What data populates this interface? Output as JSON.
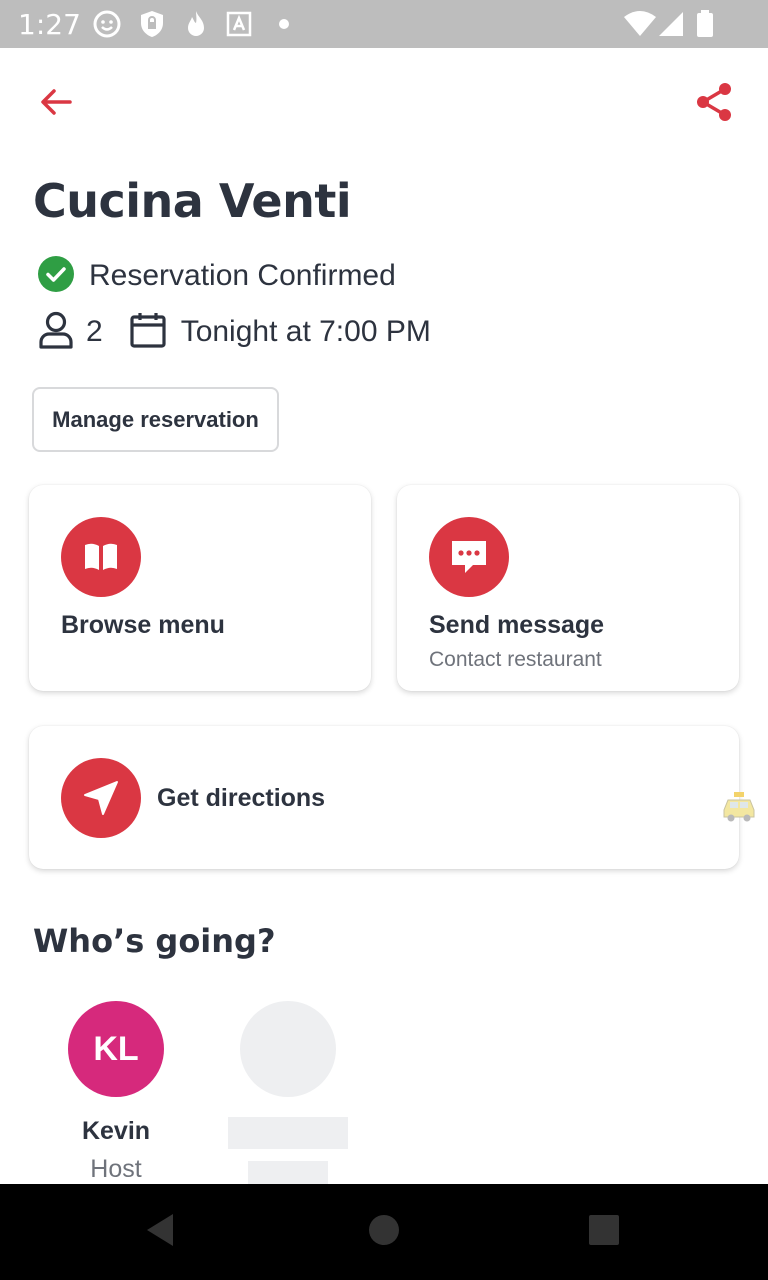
{
  "status_bar": {
    "time": "1:27",
    "icons": [
      "face-icon",
      "shield-lock-icon",
      "flame-icon",
      "font-a-icon",
      "dot-icon",
      "wifi-icon",
      "signal-icon",
      "battery-icon"
    ]
  },
  "header": {
    "back_icon": "arrow-left-icon",
    "share_icon": "share-icon",
    "accent_color": "#da3743"
  },
  "restaurant": {
    "name": "Cucina Venti"
  },
  "reservation": {
    "status": "Reservation Confirmed",
    "status_color": "#2f9e44",
    "party_size": "2",
    "datetime": "Tonight at 7:00 PM",
    "manage_label": "Manage reservation"
  },
  "actions": {
    "browse_menu": {
      "title": "Browse menu",
      "icon": "book-icon"
    },
    "send_message": {
      "title": "Send message",
      "subtitle": "Contact restaurant",
      "icon": "chat-bubble-icon"
    },
    "directions": {
      "title": "Get directions",
      "icon": "navigation-arrow-icon"
    }
  },
  "guests": {
    "title": "Who’s going?",
    "list": [
      {
        "initials": "KL",
        "name": "Kevin",
        "role": "Host",
        "color": "#d6297c"
      }
    ]
  },
  "nav_bar": {
    "icons": [
      "back-triangle-icon",
      "home-circle-icon",
      "recents-square-icon"
    ]
  }
}
